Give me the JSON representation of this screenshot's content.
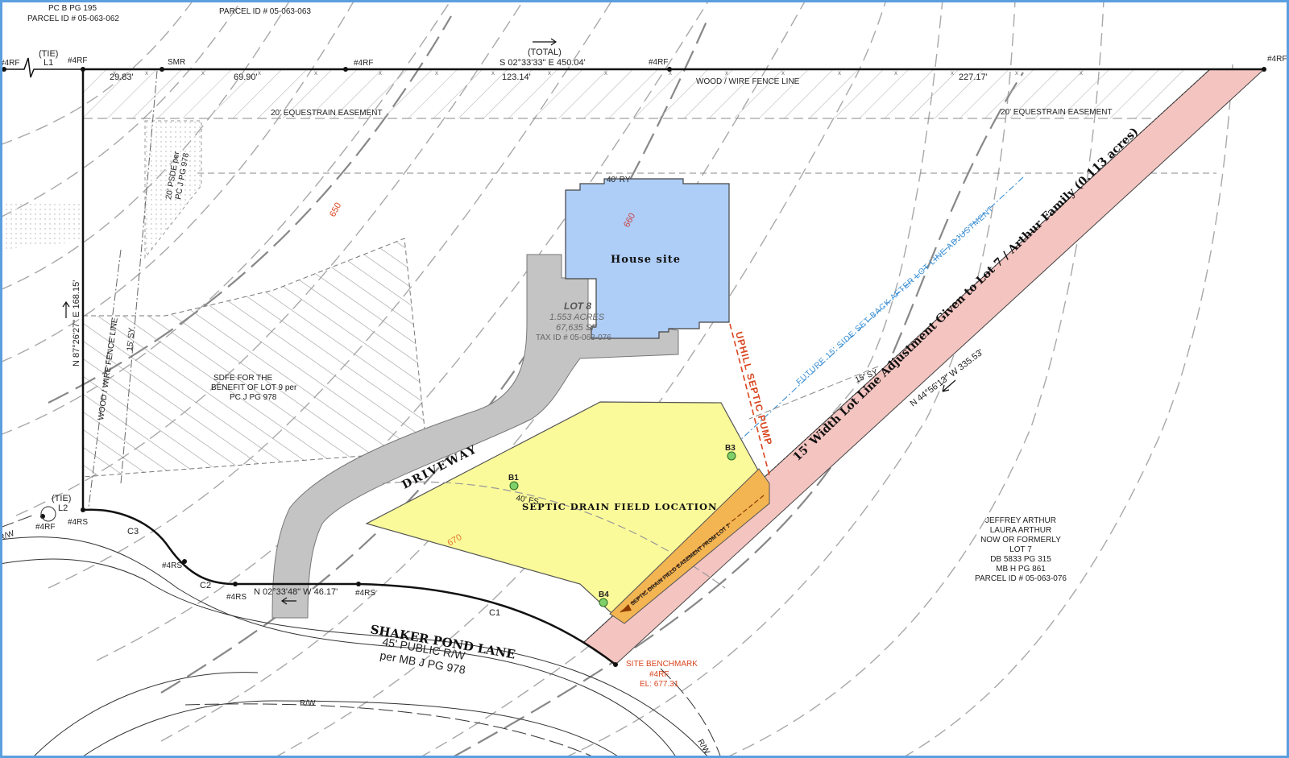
{
  "colors": {
    "house": "#aecdf7",
    "septic": "#fafa9a",
    "septic_easement": "#f3b452",
    "lot_adjustment": "#f4c4c0",
    "driveway": "#c4c4c4",
    "frame": "#5a9fe0",
    "contour": "#9a9a9a",
    "red_label": "#d9461f",
    "blue_label": "#3b8fd4"
  },
  "top_labels": {
    "left_pc": "PC B PG 195",
    "left_parcel": "PARCEL ID # 05-063-062",
    "mid_parcel": "PARCEL ID # 05-063-063"
  },
  "boundary": {
    "total": "(TOTAL)",
    "bearing_top": "S 02°33'33\" E  450.04'",
    "seg1": "29.83'",
    "seg2": "69.90'",
    "seg3": "123.14'",
    "seg4": "227.17'",
    "west": "N 87°26'27\" E  168.15'",
    "diag": "N 44°56'13\" W  335.53'",
    "street": "N 02°33'48\" W  46.17'"
  },
  "monuments": {
    "rf4": "#4RF",
    "smr": "SMR",
    "rs4": "#4RS"
  },
  "tie_labels": {
    "tie": "(TIE)",
    "l1": "L1",
    "l2": "L2",
    "c1": "C1",
    "c2": "C2",
    "c3": "C3",
    "rw": "R/W"
  },
  "features": {
    "fence_top": "WOOD / WIRE FENCE LINE",
    "fence_left": "WOOD / WIRE FENCE LINE",
    "equestrian_left": "20' EQUESTRAIN EASEMENT",
    "equestrian_right": "20' EQUESTRAIN EASEMENT",
    "psde_1": "20' PSDE per",
    "psde_2": "PC J PG 978",
    "sdfe_1": "SDFE FOR THE",
    "sdfe_2": "BENEFIT OF LOT 9 per",
    "sdfe_3": "PC J PG 978",
    "sy_left": "15' SY",
    "sy_right": "15' SY",
    "ry": "40' RY",
    "fs": "40' FS",
    "contour_650": "650",
    "contour_660": "660",
    "contour_670": "670"
  },
  "lot": {
    "name": "LOT 8",
    "acres": "1.553 ACRES",
    "sf": "67,635 SF",
    "tax": "TAX ID # 05-063-076"
  },
  "house": {
    "label": "House site"
  },
  "driveway": {
    "label": "DRIVEWAY"
  },
  "septic": {
    "label": "SEPTIC DRAIN FIELD LOCATION",
    "easement": "SEPTIC DRAIN FIELD EASEMENT FROM LOT 7",
    "pump": "UPHILL SEPTIC PUMP",
    "borings": [
      "B1",
      "B3",
      "B4"
    ]
  },
  "adjustment": {
    "main": "15' Width Lot Line Adjustment Given to Lot 7 / Arthur Family (0.113 acres)",
    "future": "FUTURE 15' SIDE SET BACK AFTER LOT LINE ADJUSTMENT"
  },
  "road": {
    "name": "SHAKER POND LANE",
    "rw": "45' PUBLIC R/W",
    "ref": "per MB J PG 978"
  },
  "benchmark": {
    "title": "SITE BENCHMARK",
    "mark": "#4RF",
    "el": "EL: 677.31"
  },
  "owner": {
    "lines": [
      "JEFFREY ARTHUR",
      "LAURA ARTHUR",
      "NOW OR FORMERLY",
      "LOT 7",
      "DB 5833 PG 315",
      "MB H  PG 861",
      "PARCEL ID # 05-063-076"
    ]
  }
}
